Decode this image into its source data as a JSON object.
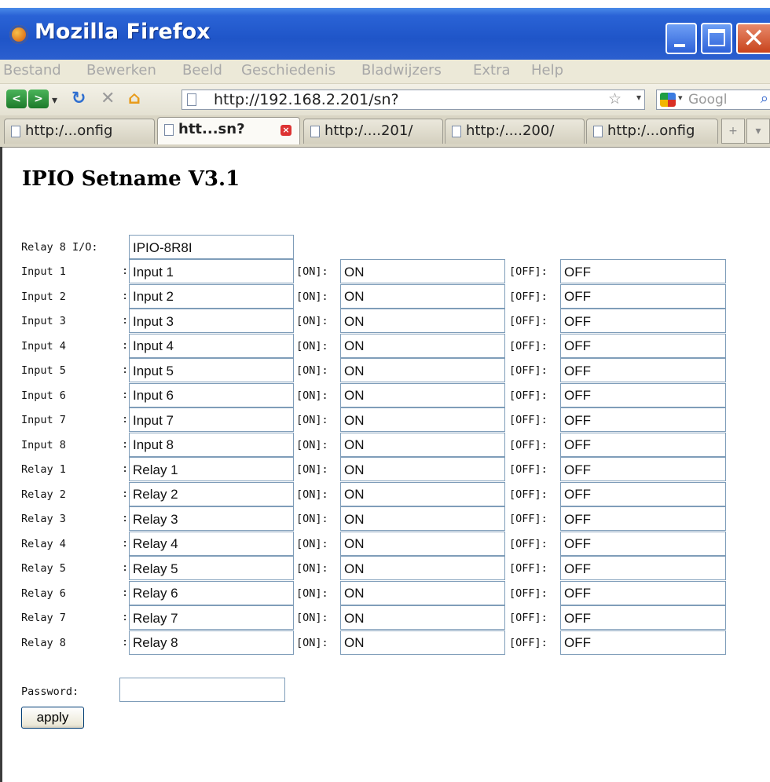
{
  "window": {
    "title": "Mozilla Firefox"
  },
  "menu": [
    "Bestand",
    "Bewerken",
    "Beeld",
    "Geschiedenis",
    "Bladwijzers",
    "Extra",
    "Help"
  ],
  "nav": {
    "url": "http://192.168.2.201/sn?",
    "search_placeholder": "Googl"
  },
  "tabs": [
    {
      "label": "http:/...onfig"
    },
    {
      "label": "htt...sn?",
      "active": true
    },
    {
      "label": "http:/....201/"
    },
    {
      "label": "http:/....200/"
    },
    {
      "label": "http:/...onfig"
    }
  ],
  "page": {
    "title": "IPIO Setname V3.1",
    "device": {
      "label": "Relay 8 I/O:",
      "value": "IPIO-8R8I"
    },
    "on_tag": "[ON]:",
    "off_tag": "[OFF]:",
    "rows": [
      {
        "label": "Input 1",
        "name": "Input 1",
        "on": "ON",
        "off": "OFF"
      },
      {
        "label": "Input 2",
        "name": "Input 2",
        "on": "ON",
        "off": "OFF"
      },
      {
        "label": "Input 3",
        "name": "Input 3",
        "on": "ON",
        "off": "OFF"
      },
      {
        "label": "Input 4",
        "name": "Input 4",
        "on": "ON",
        "off": "OFF"
      },
      {
        "label": "Input 5",
        "name": "Input 5",
        "on": "ON",
        "off": "OFF"
      },
      {
        "label": "Input 6",
        "name": "Input 6",
        "on": "ON",
        "off": "OFF"
      },
      {
        "label": "Input 7",
        "name": "Input 7",
        "on": "ON",
        "off": "OFF"
      },
      {
        "label": "Input 8",
        "name": "Input 8",
        "on": "ON",
        "off": "OFF"
      },
      {
        "label": "Relay 1",
        "name": "Relay 1",
        "on": "ON",
        "off": "OFF"
      },
      {
        "label": "Relay 2",
        "name": "Relay 2",
        "on": "ON",
        "off": "OFF"
      },
      {
        "label": "Relay 3",
        "name": "Relay 3",
        "on": "ON",
        "off": "OFF"
      },
      {
        "label": "Relay 4",
        "name": "Relay 4",
        "on": "ON",
        "off": "OFF"
      },
      {
        "label": "Relay 5",
        "name": "Relay 5",
        "on": "ON",
        "off": "OFF"
      },
      {
        "label": "Relay 6",
        "name": "Relay 6",
        "on": "ON",
        "off": "OFF"
      },
      {
        "label": "Relay 7",
        "name": "Relay 7",
        "on": "ON",
        "off": "OFF"
      },
      {
        "label": "Relay 8",
        "name": "Relay 8",
        "on": "ON",
        "off": "OFF"
      }
    ],
    "password_label": "Password:",
    "password_value": "",
    "apply_label": "apply"
  }
}
